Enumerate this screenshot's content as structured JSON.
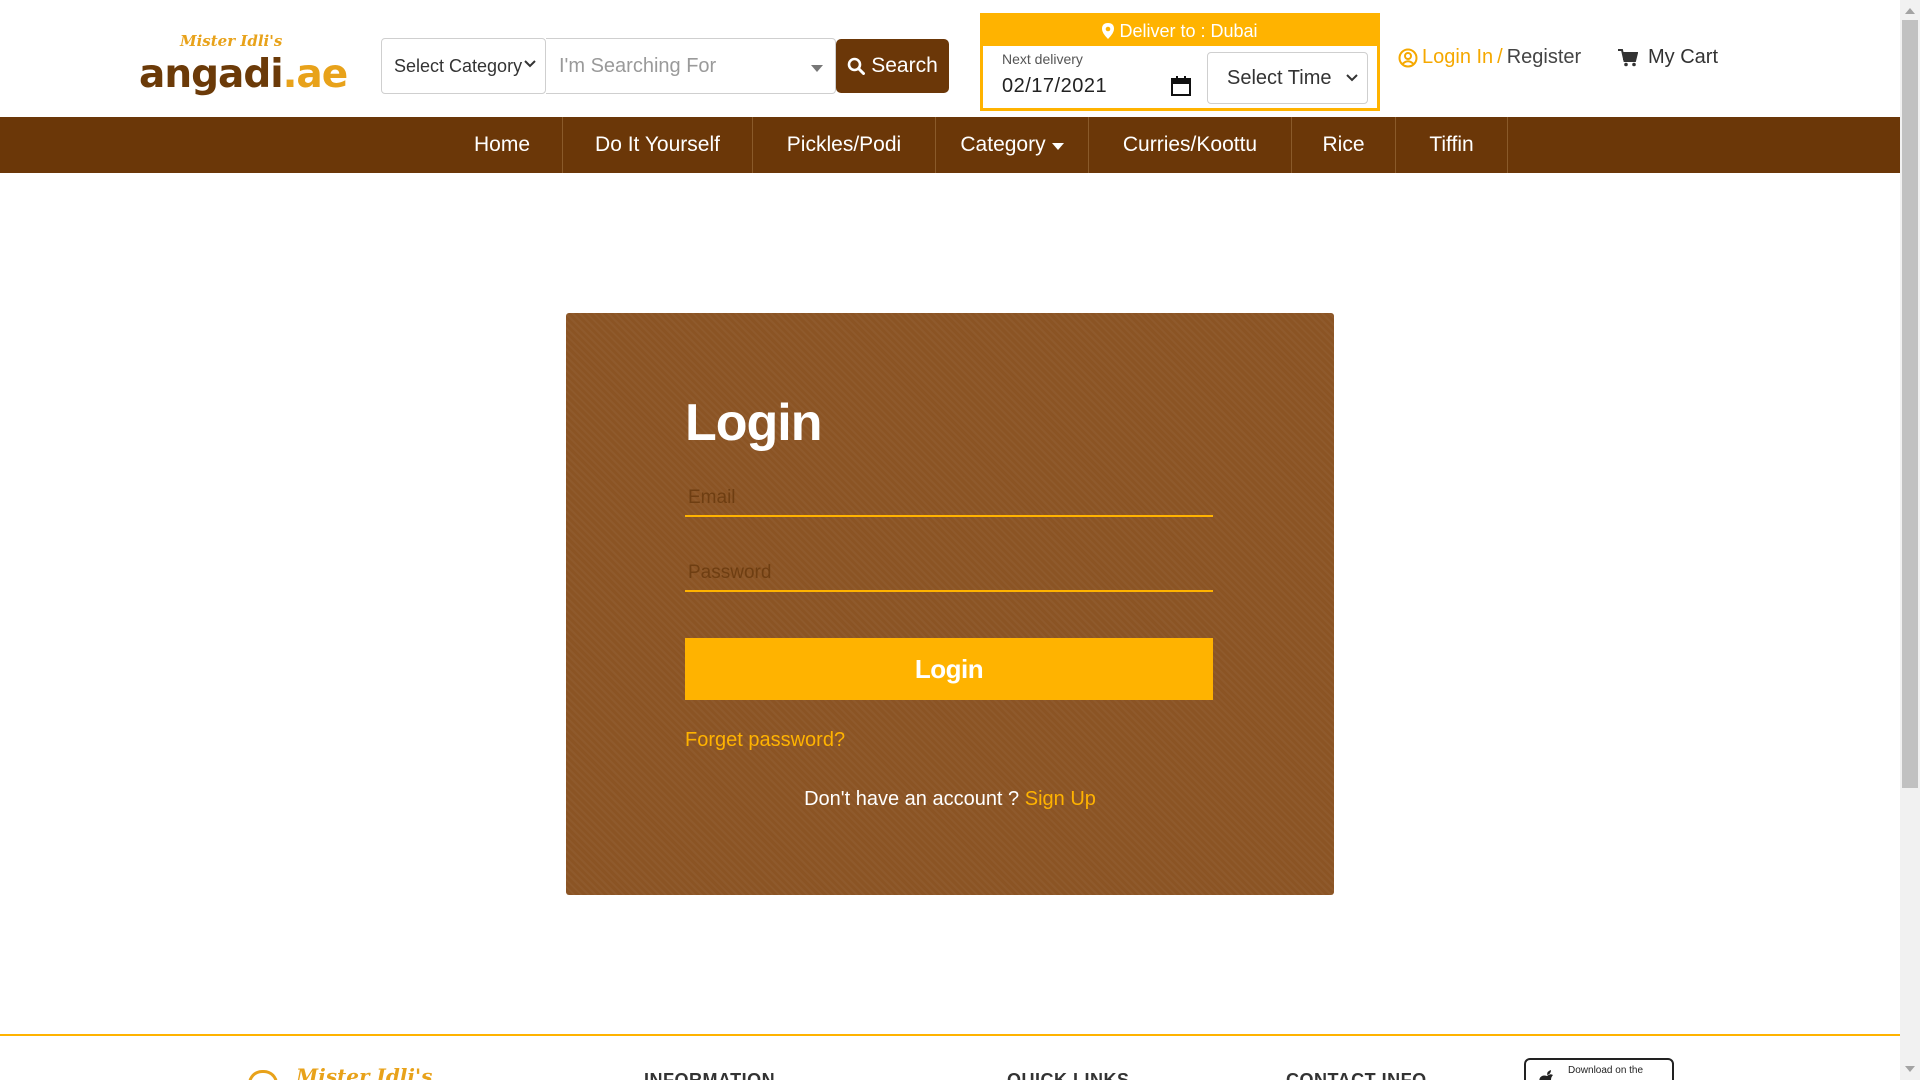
{
  "header": {
    "logo": {
      "script_text": "Mister Idli's",
      "main_text": "angadi",
      "suffix_text": ".ae"
    },
    "category_select": {
      "selected": "Select Category"
    },
    "search": {
      "placeholder": "I'm Searching For",
      "button_label": "Search"
    },
    "delivery": {
      "deliver_to_label": "Deliver to : Dubai",
      "next_delivery_label": "Next delivery",
      "date_value": "02/17/2021",
      "time_select": "Select Time"
    },
    "account": {
      "login_label": "Login In",
      "separator": "/",
      "register_label": "Register"
    },
    "cart": {
      "label": "My Cart"
    }
  },
  "nav": {
    "items": [
      {
        "label": "Home"
      },
      {
        "label": "Do It Yourself"
      },
      {
        "label": "Pickles/Podi"
      },
      {
        "label": "Category",
        "has_dropdown": true
      },
      {
        "label": "Curries/Koottu"
      },
      {
        "label": "Rice"
      },
      {
        "label": "Tiffin"
      }
    ]
  },
  "login": {
    "title": "Login",
    "email_placeholder": "Email",
    "password_placeholder": "Password",
    "button_label": "Login",
    "forget_password": "Forget password?",
    "no_account_text": "Don't have an account ?",
    "signup_link": "Sign Up"
  },
  "footer": {
    "logo_script": "Mister Idli's",
    "headings": [
      "INFORMATION",
      "QUICK LINKS",
      "CONTACT INFO"
    ],
    "app_badge_text": "Download on the"
  },
  "colors": {
    "brand_brown": "#6b3708",
    "card_brown": "#8b5424",
    "accent_orange": "#ffb300"
  },
  "icons": [
    "bag-logo-icon",
    "chevron-down-icon",
    "search-icon",
    "map-marker-icon",
    "calendar-icon",
    "user-circle-icon",
    "cart-icon",
    "caret-down-icon",
    "apple-icon"
  ]
}
